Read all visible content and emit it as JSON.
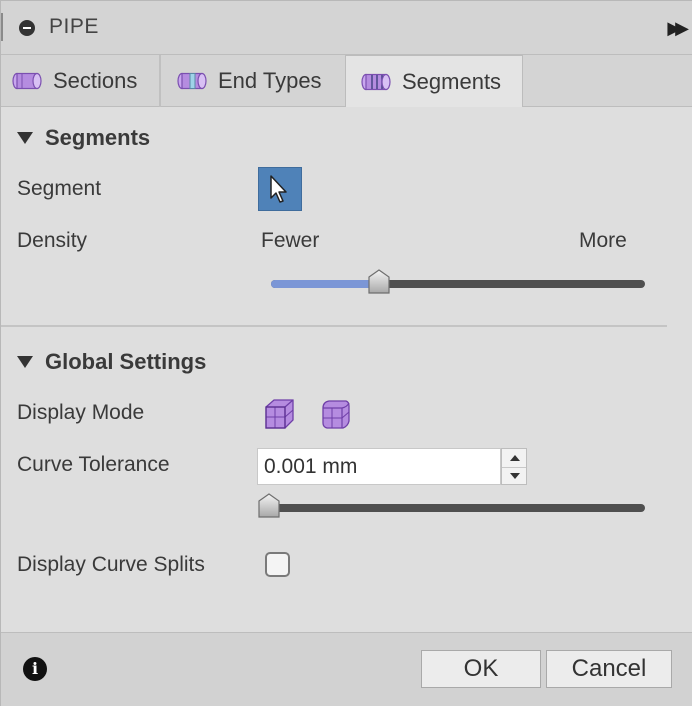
{
  "window": {
    "title": "PIPE"
  },
  "tabs": [
    {
      "label": "Sections",
      "icon": "pipe-section-icon"
    },
    {
      "label": "End Types",
      "icon": "pipe-end-types-icon"
    },
    {
      "label": "Segments",
      "icon": "pipe-segments-icon",
      "active": true
    }
  ],
  "segments_section": {
    "heading": "Segments",
    "segment_label": "Segment",
    "segment_icon": "cursor-select-icon",
    "density_label": "Density",
    "density_min_label": "Fewer",
    "density_max_label": "More",
    "density_value_fraction": 0.29
  },
  "global_section": {
    "heading": "Global Settings",
    "display_mode_label": "Display Mode",
    "display_mode_icons": [
      "solid-cube-icon",
      "rounded-cube-icon"
    ],
    "curve_tolerance_label": "Curve Tolerance",
    "curve_tolerance_value": "0.001 mm",
    "curve_tolerance_slider_fraction": 0.0,
    "display_curve_splits_label": "Display Curve Splits",
    "display_curve_splits_checked": false
  },
  "footer": {
    "ok_label": "OK",
    "cancel_label": "Cancel"
  },
  "colors": {
    "accent_blue": "#4f82b8",
    "slider_fill": "#7b96d6",
    "icon_purple": "#b58ce0"
  }
}
